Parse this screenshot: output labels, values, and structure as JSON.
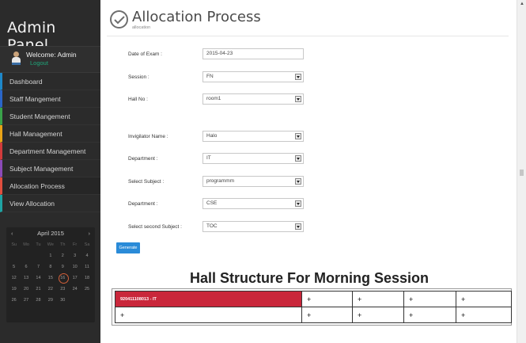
{
  "sidebar": {
    "brand": "Admin Panel",
    "welcome": "Welcome: Admin",
    "logout": "Logout",
    "items": [
      {
        "label": "Dashboard"
      },
      {
        "label": "Staff Mangement"
      },
      {
        "label": "Student Mangement"
      },
      {
        "label": "Hall Management"
      },
      {
        "label": "Department Management"
      },
      {
        "label": "Subject Management"
      },
      {
        "label": "Allocation Process"
      },
      {
        "label": "View Allocation"
      }
    ],
    "calendar": {
      "title": "April 2015",
      "prev": "‹",
      "next": "›",
      "days_of_week": [
        "Su",
        "Mo",
        "Tu",
        "We",
        "Th",
        "Fr",
        "Sa"
      ],
      "weeks": [
        [
          "",
          "",
          "",
          "1",
          "2",
          "3",
          "4"
        ],
        [
          "5",
          "6",
          "7",
          "8",
          "9",
          "10",
          "11"
        ],
        [
          "12",
          "13",
          "14",
          "15",
          "16",
          "17",
          "18"
        ],
        [
          "19",
          "20",
          "21",
          "22",
          "23",
          "24",
          "25"
        ],
        [
          "26",
          "27",
          "28",
          "29",
          "30",
          "",
          ""
        ]
      ],
      "today": "16"
    }
  },
  "header": {
    "title": "Allocation Process",
    "subtitle": "allocation"
  },
  "form": {
    "date_label": "Date of Exam :",
    "date_value": "2015-04-23",
    "session_label": "Session :",
    "session_value": "FN",
    "hall_label": "Hall No :",
    "hall_value": "room1",
    "invigilator_label": "Invigilator Name :",
    "invigilator_value": "Halo",
    "department_label": "Department :",
    "department_value": "IT",
    "subject_label": "Select Subject :",
    "subject_value": "programmm",
    "department2_label": "Department :",
    "department2_value": "CSE",
    "subject2_label": "Select second Subject :",
    "subject2_value": "TOC",
    "generate": "Generate"
  },
  "hall": {
    "title": "Hall Structure For Morning Session",
    "rows": [
      [
        "920411108013 - IT",
        "+",
        "+",
        "+",
        "+"
      ],
      [
        "+",
        "+",
        "+",
        "+",
        "+"
      ]
    ]
  },
  "colors": {
    "sidebar_bg": "#2b2b2b",
    "occupied_seat": "#c9273b",
    "primary_button": "#2a8bd8",
    "logout_link": "#1fa67a"
  }
}
